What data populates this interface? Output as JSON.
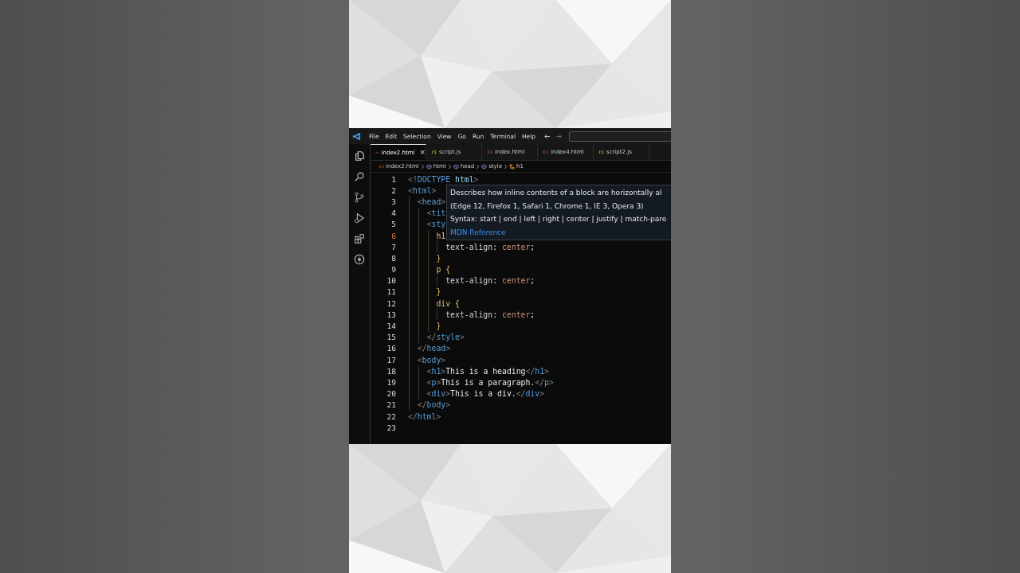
{
  "menu": [
    "File",
    "Edit",
    "Selection",
    "View",
    "Go",
    "Run",
    "Terminal",
    "Help"
  ],
  "tabs": [
    {
      "label": "index2.html",
      "kind": "html",
      "selected": true,
      "close": "×"
    },
    {
      "label": "script.js",
      "kind": "js",
      "selected": false
    },
    {
      "label": "index.html",
      "kind": "html",
      "selected": false
    },
    {
      "label": "index4.html",
      "kind": "html",
      "selected": false
    },
    {
      "label": "script2.js",
      "kind": "js",
      "selected": false
    }
  ],
  "breadcrumb": [
    {
      "label": "index2.html",
      "kind": "file"
    },
    {
      "label": "html",
      "kind": "element"
    },
    {
      "label": "head",
      "kind": "element"
    },
    {
      "label": "style",
      "kind": "element"
    },
    {
      "label": "h1",
      "kind": "rule"
    }
  ],
  "lines": [
    {
      "number": "1",
      "current": false,
      "tokens": [
        {
          "kind": "bracket",
          "text": "<!"
        },
        {
          "kind": "tag",
          "text": "DOCTYPE"
        },
        {
          "kind": "attr",
          "text": " html"
        },
        {
          "kind": "bracket",
          "text": ">"
        }
      ]
    },
    {
      "number": "2",
      "current": false,
      "tokens": [
        {
          "kind": "bracket",
          "text": "<"
        },
        {
          "kind": "tag",
          "text": "html"
        },
        {
          "kind": "bracket",
          "text": ">"
        }
      ]
    },
    {
      "number": "3",
      "current": false,
      "tokens": [
        {
          "kind": "bracket",
          "text": "  <"
        },
        {
          "kind": "tag",
          "text": "head"
        },
        {
          "kind": "bracket",
          "text": ">"
        }
      ]
    },
    {
      "number": "4",
      "current": false,
      "tokens": [
        {
          "kind": "bracket",
          "text": "    <"
        },
        {
          "kind": "tag",
          "text": "tit"
        }
      ]
    },
    {
      "number": "5",
      "current": false,
      "tokens": [
        {
          "kind": "bracket",
          "text": "    <"
        },
        {
          "kind": "tag",
          "text": "sty"
        }
      ]
    },
    {
      "number": "6",
      "current": true,
      "tokens": [
        {
          "kind": "selector",
          "text": "      h1"
        }
      ]
    },
    {
      "number": "7",
      "current": false,
      "tokens": [
        {
          "kind": "prop",
          "text": "        text-align"
        },
        {
          "kind": "text",
          "text": ": "
        },
        {
          "kind": "value",
          "text": "center"
        },
        {
          "kind": "text",
          "text": ";"
        }
      ]
    },
    {
      "number": "8",
      "current": false,
      "tokens": [
        {
          "kind": "brace",
          "text": "      }"
        }
      ]
    },
    {
      "number": "9",
      "current": false,
      "tokens": [
        {
          "kind": "selector",
          "text": "      p"
        },
        {
          "kind": "brace",
          "text": " {"
        }
      ]
    },
    {
      "number": "10",
      "current": false,
      "tokens": [
        {
          "kind": "prop",
          "text": "        text-align"
        },
        {
          "kind": "text",
          "text": ": "
        },
        {
          "kind": "value",
          "text": "center"
        },
        {
          "kind": "text",
          "text": ";"
        }
      ]
    },
    {
      "number": "11",
      "current": false,
      "tokens": [
        {
          "kind": "brace",
          "text": "      }"
        }
      ]
    },
    {
      "number": "12",
      "current": false,
      "tokens": [
        {
          "kind": "selector",
          "text": "      div"
        },
        {
          "kind": "brace",
          "text": " {"
        }
      ]
    },
    {
      "number": "13",
      "current": false,
      "tokens": [
        {
          "kind": "prop",
          "text": "        text-align"
        },
        {
          "kind": "text",
          "text": ": "
        },
        {
          "kind": "value",
          "text": "center"
        },
        {
          "kind": "text",
          "text": ";"
        }
      ]
    },
    {
      "number": "14",
      "current": false,
      "tokens": [
        {
          "kind": "brace",
          "text": "      }"
        }
      ]
    },
    {
      "number": "15",
      "current": false,
      "tokens": [
        {
          "kind": "bracket",
          "text": "    </"
        },
        {
          "kind": "tag",
          "text": "style"
        },
        {
          "kind": "bracket",
          "text": ">"
        }
      ]
    },
    {
      "number": "16",
      "current": false,
      "tokens": [
        {
          "kind": "bracket",
          "text": "  </"
        },
        {
          "kind": "tag",
          "text": "head"
        },
        {
          "kind": "bracket",
          "text": ">"
        }
      ]
    },
    {
      "number": "17",
      "current": false,
      "tokens": [
        {
          "kind": "bracket",
          "text": "  <"
        },
        {
          "kind": "tag",
          "text": "body"
        },
        {
          "kind": "bracket",
          "text": ">"
        }
      ]
    },
    {
      "number": "18",
      "current": false,
      "tokens": [
        {
          "kind": "bracket",
          "text": "    <"
        },
        {
          "kind": "tag",
          "text": "h1"
        },
        {
          "kind": "bracket",
          "text": ">"
        },
        {
          "kind": "text",
          "text": "This is a heading"
        },
        {
          "kind": "bracket",
          "text": "</"
        },
        {
          "kind": "tag",
          "text": "h1"
        },
        {
          "kind": "bracket",
          "text": ">"
        }
      ]
    },
    {
      "number": "19",
      "current": false,
      "tokens": [
        {
          "kind": "bracket",
          "text": "    <"
        },
        {
          "kind": "tag",
          "text": "p"
        },
        {
          "kind": "bracket",
          "text": ">"
        },
        {
          "kind": "text",
          "text": "This is a paragraph."
        },
        {
          "kind": "bracket",
          "text": "</"
        },
        {
          "kind": "tag",
          "text": "p"
        },
        {
          "kind": "bracket",
          "text": ">"
        }
      ]
    },
    {
      "number": "20",
      "current": false,
      "tokens": [
        {
          "kind": "bracket",
          "text": "    <"
        },
        {
          "kind": "tag",
          "text": "div"
        },
        {
          "kind": "bracket",
          "text": ">"
        },
        {
          "kind": "text",
          "text": "This is a div."
        },
        {
          "kind": "bracket",
          "text": "</"
        },
        {
          "kind": "tag",
          "text": "div"
        },
        {
          "kind": "bracket",
          "text": ">"
        }
      ]
    },
    {
      "number": "21",
      "current": false,
      "tokens": [
        {
          "kind": "bracket",
          "text": "  </"
        },
        {
          "kind": "tag",
          "text": "body"
        },
        {
          "kind": "bracket",
          "text": ">"
        }
      ]
    },
    {
      "number": "22",
      "current": false,
      "tokens": [
        {
          "kind": "bracket",
          "text": "</"
        },
        {
          "kind": "tag",
          "text": "html"
        },
        {
          "kind": "bracket",
          "text": ">"
        }
      ]
    },
    {
      "number": "23",
      "current": false
    }
  ],
  "hover": [
    {
      "kind": "text",
      "text": "Describes how inline contents of a block are horizontally al"
    },
    {
      "kind": "text",
      "text": "(Edge 12, Firefox 1, Safari 1, Chrome 1, IE 3, Opera 3)"
    },
    {
      "kind": "text",
      "text": "Syntax: start | end | left | right | center | justify | match-pare"
    },
    {
      "kind": "link",
      "text": "MDN Reference"
    }
  ]
}
